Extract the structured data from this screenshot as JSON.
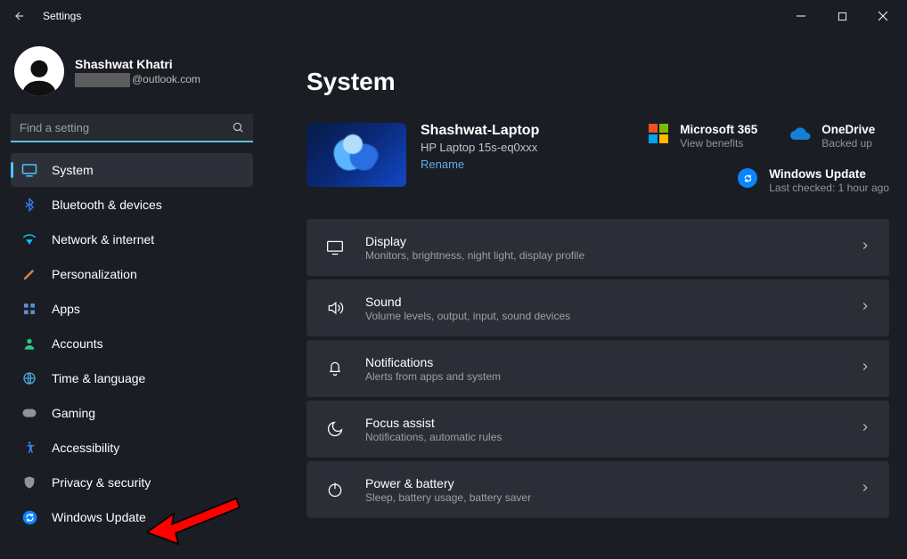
{
  "window": {
    "title": "Settings"
  },
  "user": {
    "name": "Shashwat Khatri",
    "email_suffix": "@outlook.com"
  },
  "search": {
    "placeholder": "Find a setting"
  },
  "sidebar": {
    "items": [
      {
        "label": "System",
        "active": true
      },
      {
        "label": "Bluetooth & devices"
      },
      {
        "label": "Network & internet"
      },
      {
        "label": "Personalization"
      },
      {
        "label": "Apps"
      },
      {
        "label": "Accounts"
      },
      {
        "label": "Time & language"
      },
      {
        "label": "Gaming"
      },
      {
        "label": "Accessibility"
      },
      {
        "label": "Privacy & security"
      },
      {
        "label": "Windows Update"
      }
    ]
  },
  "page": {
    "title": "System"
  },
  "device": {
    "name": "Shashwat-Laptop",
    "model": "HP Laptop 15s-eq0xxx",
    "rename": "Rename"
  },
  "tiles": {
    "ms365": {
      "title": "Microsoft 365",
      "sub": "View benefits"
    },
    "onedrive": {
      "title": "OneDrive",
      "sub": "Backed up"
    },
    "wu": {
      "title": "Windows Update",
      "sub": "Last checked: 1 hour ago"
    }
  },
  "cards": [
    {
      "title": "Display",
      "sub": "Monitors, brightness, night light, display profile"
    },
    {
      "title": "Sound",
      "sub": "Volume levels, output, input, sound devices"
    },
    {
      "title": "Notifications",
      "sub": "Alerts from apps and system"
    },
    {
      "title": "Focus assist",
      "sub": "Notifications, automatic rules"
    },
    {
      "title": "Power & battery",
      "sub": "Sleep, battery usage, battery saver"
    }
  ]
}
